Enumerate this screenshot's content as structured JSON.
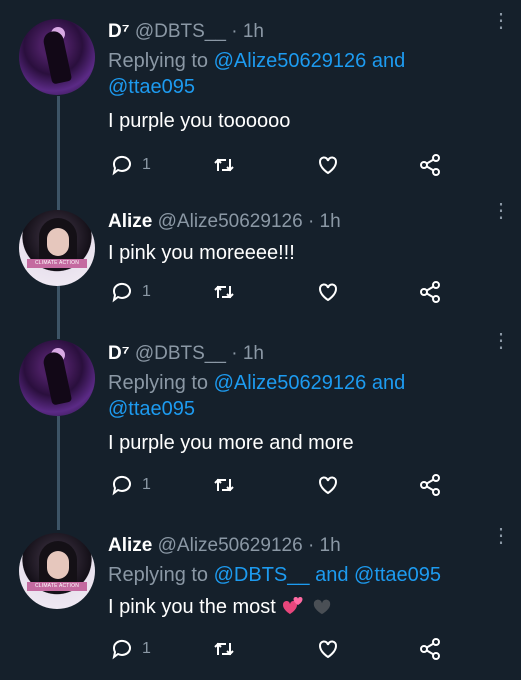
{
  "colors": {
    "background": "#15202b",
    "accent": "#1d9bf0",
    "muted": "#8b98a5",
    "thread_line": "#3d5466"
  },
  "tweets": [
    {
      "name": "D⁷",
      "handle": "@DBTS__",
      "dot": "·",
      "time": "1h",
      "replying_prefix": "Replying to",
      "reply_mention_1": "@Alize50629126",
      "reply_and": "and",
      "reply_mention_2": "@ttae095",
      "text": "I purple you toooooo",
      "reply_count": "1"
    },
    {
      "name": "Alize",
      "handle": "@Alize50629126",
      "dot": "·",
      "time": "1h",
      "avatar_banner": "CLIMATE ACTION",
      "text": "I pink you moreeee!!!",
      "reply_count": "1"
    },
    {
      "name": "D⁷",
      "handle": "@DBTS__",
      "dot": "·",
      "time": "1h",
      "replying_prefix": "Replying to",
      "reply_mention_1": "@Alize50629126",
      "reply_and": "and",
      "reply_mention_2": "@ttae095",
      "text": "I purple you more and more",
      "reply_count": "1"
    },
    {
      "name": "Alize",
      "handle": "@Alize50629126",
      "dot": "·",
      "time": "1h",
      "avatar_banner": "CLIMATE ACTION",
      "replying_prefix": "Replying to",
      "reply_mention_1": "@DBTS__",
      "reply_and": "and",
      "reply_mention_2": "@ttae095",
      "text": "I pink you the most",
      "reply_count": "1"
    }
  ]
}
